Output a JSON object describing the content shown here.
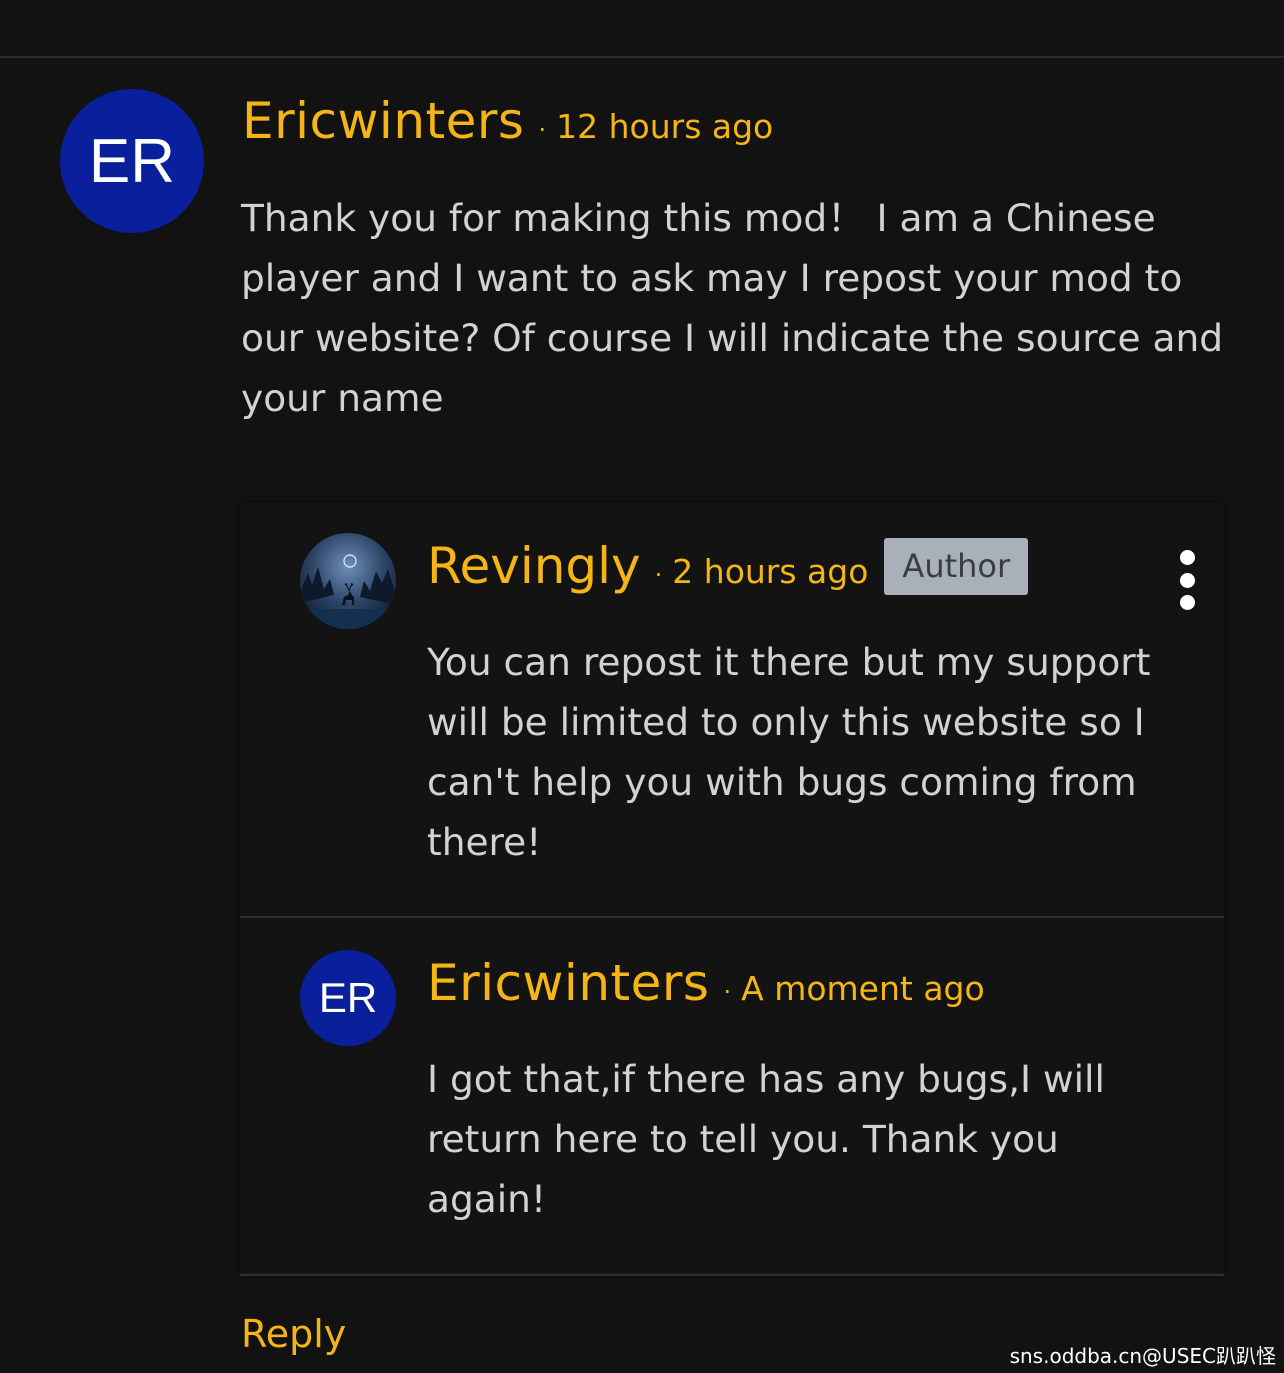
{
  "main_comment": {
    "avatar_initials": "ER",
    "author": "Ericwinters",
    "separator": "·",
    "time": "12 hours ago",
    "text": "Thank you for making this mod！ I am a Chinese player and I want to ask may I repost your mod to our website? Of course I will indicate the source and your name"
  },
  "replies": [
    {
      "avatar_icon": "deer-forest-avatar",
      "author": "Revingly",
      "separator": "·",
      "time": "2 hours ago",
      "badge": "Author",
      "menu_icon": "kebab-menu-icon",
      "text": "You can repost it there but my support will be limited to only this website so I can't help you with bugs coming from there!"
    },
    {
      "avatar_initials": "ER",
      "author": "Ericwinters",
      "separator": "·",
      "time": "A moment ago",
      "text": "I got that,if there has any bugs,I will return here to tell you. Thank you again!"
    }
  ],
  "actions": {
    "reply_label": "Reply"
  },
  "watermark": "sns.oddba.cn@USEC趴趴怪",
  "colors": {
    "background": "#121212",
    "accent": "#f5b516",
    "text": "#d2d2d2",
    "avatar_bg": "#0a1f9b",
    "badge_bg": "#aab0ba"
  }
}
